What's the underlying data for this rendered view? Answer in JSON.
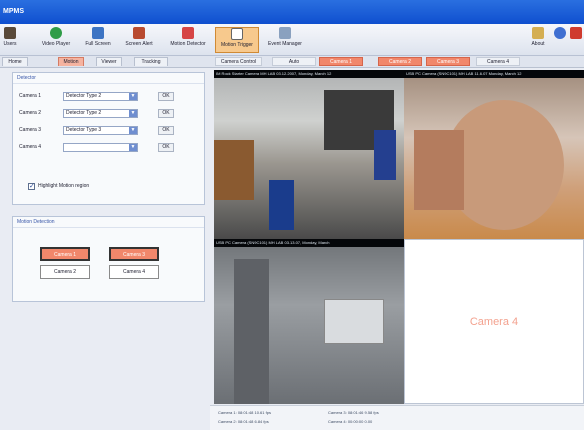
{
  "window": {
    "title": "MPMS"
  },
  "toolbar": {
    "items": [
      {
        "label": "Users",
        "icon": "users-icon",
        "color": "#5a4a3a"
      },
      {
        "label": "Video Player",
        "icon": "video-player-icon",
        "color": "#2f9c47"
      },
      {
        "label": "Full Screen",
        "icon": "full-screen-icon",
        "color": "#3d74c3"
      },
      {
        "label": "Screen Alert",
        "icon": "screen-alert-icon",
        "color": "#b84a2f"
      },
      {
        "label": "Motion Detector",
        "icon": "motion-detector-icon",
        "color": "#d64545"
      },
      {
        "label": "Motion Trigger",
        "icon": "motion-trigger-icon",
        "color": "#f2b05a"
      },
      {
        "label": "Event Manager",
        "icon": "event-manager-icon",
        "color": "#8aa1bf"
      }
    ],
    "right": [
      {
        "label": "About",
        "icon": "about-icon"
      },
      {
        "label": "Help",
        "icon": "help-icon"
      },
      {
        "label": "Close",
        "icon": "close-icon"
      }
    ]
  },
  "tabs": {
    "main": [
      "Home",
      "Motion",
      "Viewer",
      "Tracking"
    ],
    "camera_controls": [
      "Camera Control",
      "Auto",
      "Camera 1",
      "Camera 2",
      "Camera 3",
      "Camera 4"
    ]
  },
  "detector": {
    "title": "Detector",
    "rows": [
      {
        "label": "Camera 1",
        "value": "Detector Type 2",
        "ok": "OK"
      },
      {
        "label": "Camera 2",
        "value": "Detector Type 2",
        "ok": "OK"
      },
      {
        "label": "Camera 3",
        "value": "Detector Type 3",
        "ok": "OK"
      },
      {
        "label": "Camera 4",
        "value": "",
        "ok": "OK"
      }
    ],
    "highlight": {
      "label": "Highlight Motion region",
      "checked": true
    }
  },
  "motion_detection": {
    "title": "Motion Detection",
    "buttons": [
      {
        "label": "Camera 1",
        "active": true
      },
      {
        "label": "Camera 3",
        "active": true
      },
      {
        "label": "Camera 2",
        "active": false
      },
      {
        "label": "Camera 4",
        "active": false
      }
    ]
  },
  "videos": [
    {
      "header": "IM Rock Starter Camera  MH LAB 03.12.2007, Monday, March 12"
    },
    {
      "header": "USB PC Camera (SN9C101)  MH LAB 11.6.07 Monday, March 12"
    },
    {
      "header": "USB PC Camera (SN9C101)  MH LAB 03.13.07, Monday, March"
    },
    {
      "placeholder": "Camera 4"
    }
  ],
  "status": {
    "items": [
      {
        "label": "Camera 1:",
        "value": "08:01:48  10.61 fps"
      },
      {
        "label": "Camera 3:",
        "value": "08:01:46  9.58 fps"
      },
      {
        "label": "Camera 2:",
        "value": "08:01:48  6.84 fps"
      },
      {
        "label": "Camera 4:",
        "value": "00:00:00  0.00"
      }
    ]
  },
  "colors": {
    "accent": "#f1876b",
    "title_bar": "#0f4fcf",
    "panel_title": "#3856a8",
    "placeholder_text": "#f3a28f"
  }
}
